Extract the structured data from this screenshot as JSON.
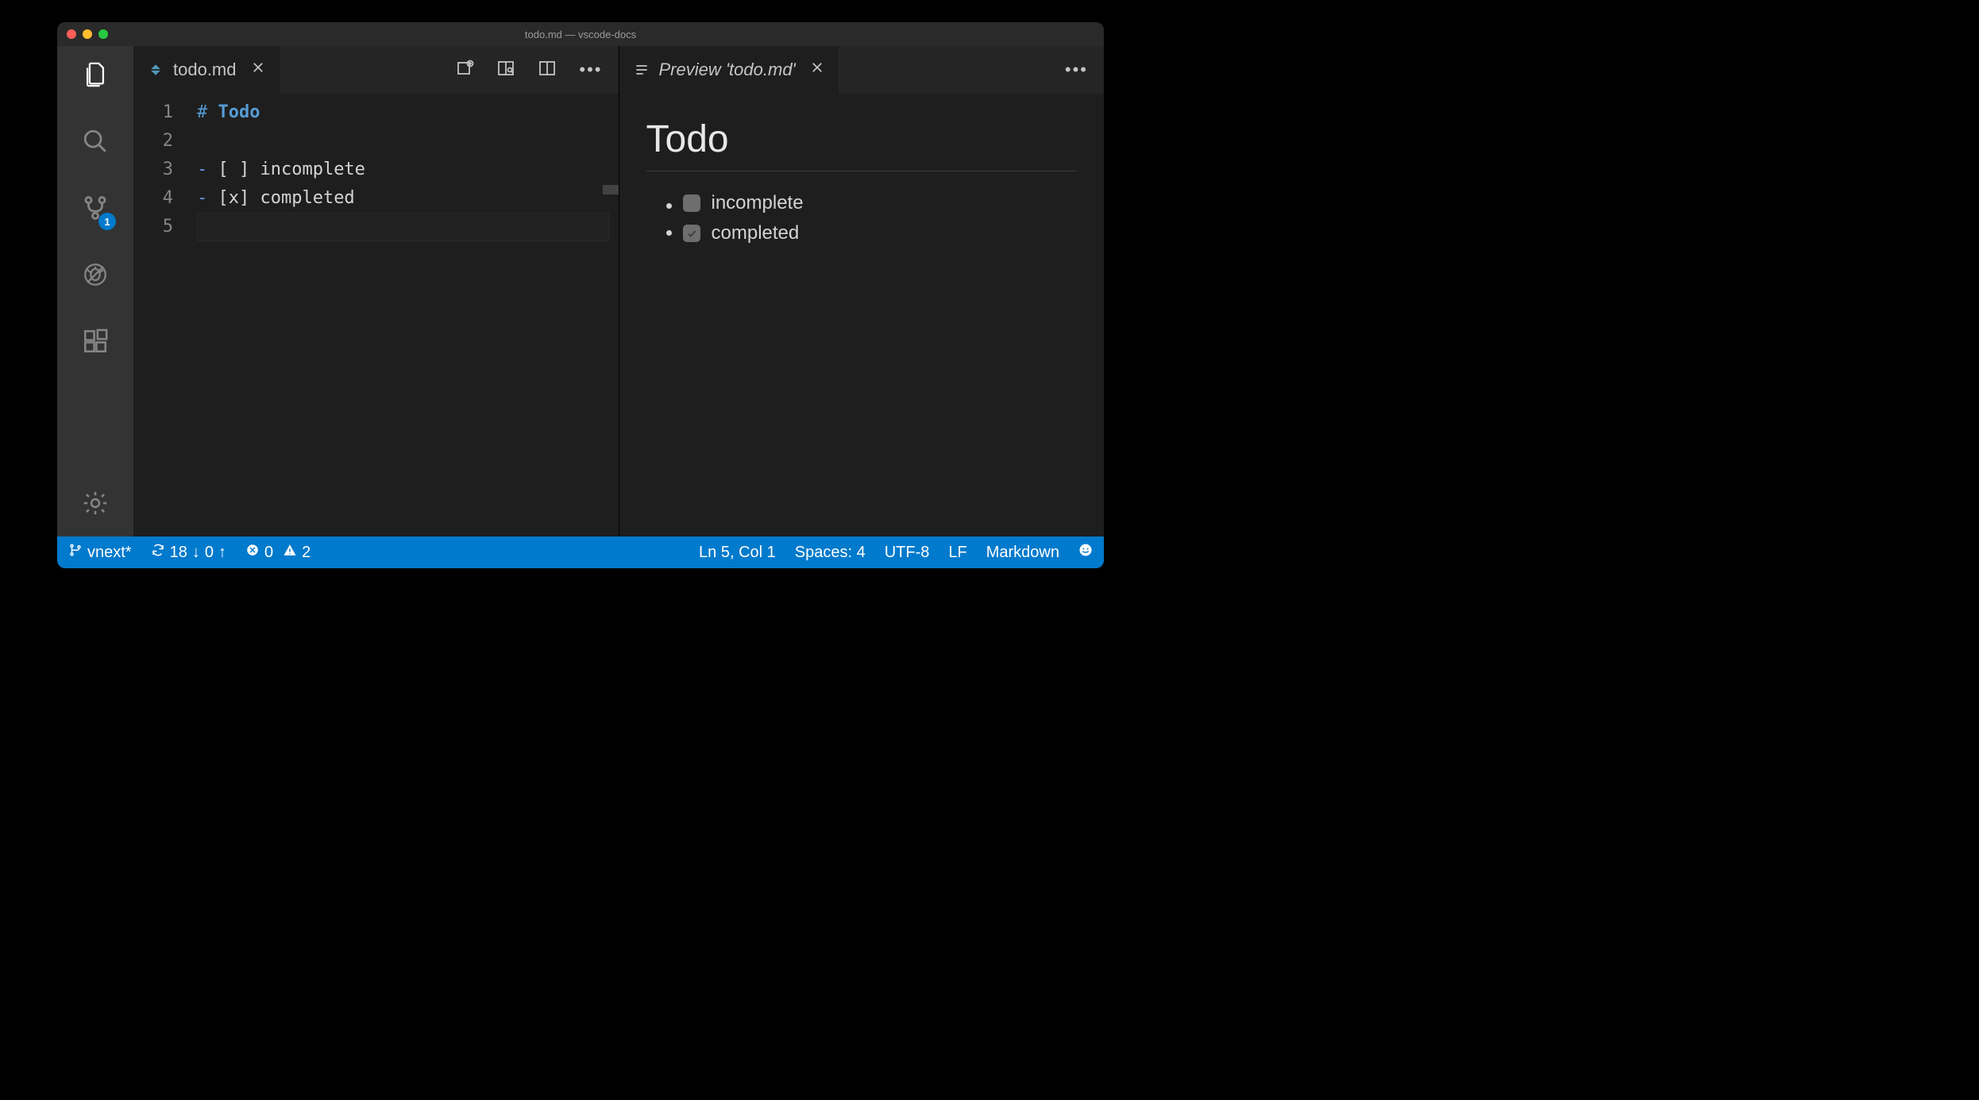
{
  "window": {
    "title": "todo.md — vscode-docs"
  },
  "activity_bar": {
    "scm_badge": "1"
  },
  "editor_left": {
    "tab_label": "todo.md",
    "lines": {
      "1": {
        "num": "1",
        "hash": "#",
        "heading": " Todo"
      },
      "2": {
        "num": "2",
        "text": ""
      },
      "3": {
        "num": "3",
        "dash": "-",
        "rest": " [ ] incomplete"
      },
      "4": {
        "num": "4",
        "dash": "-",
        "rest": " [x] completed"
      },
      "5": {
        "num": "5",
        "text": ""
      }
    }
  },
  "editor_right": {
    "tab_label": "Preview 'todo.md'",
    "heading": "Todo",
    "items": [
      {
        "label": "incomplete",
        "checked": false
      },
      {
        "label": "completed",
        "checked": true
      }
    ]
  },
  "status": {
    "branch": "vnext*",
    "sync_in": "18",
    "sync_out": "0",
    "errors": "0",
    "warnings": "2",
    "cursor": "Ln 5, Col 1",
    "indent": "Spaces: 4",
    "encoding": "UTF-8",
    "eol": "LF",
    "language": "Markdown"
  }
}
